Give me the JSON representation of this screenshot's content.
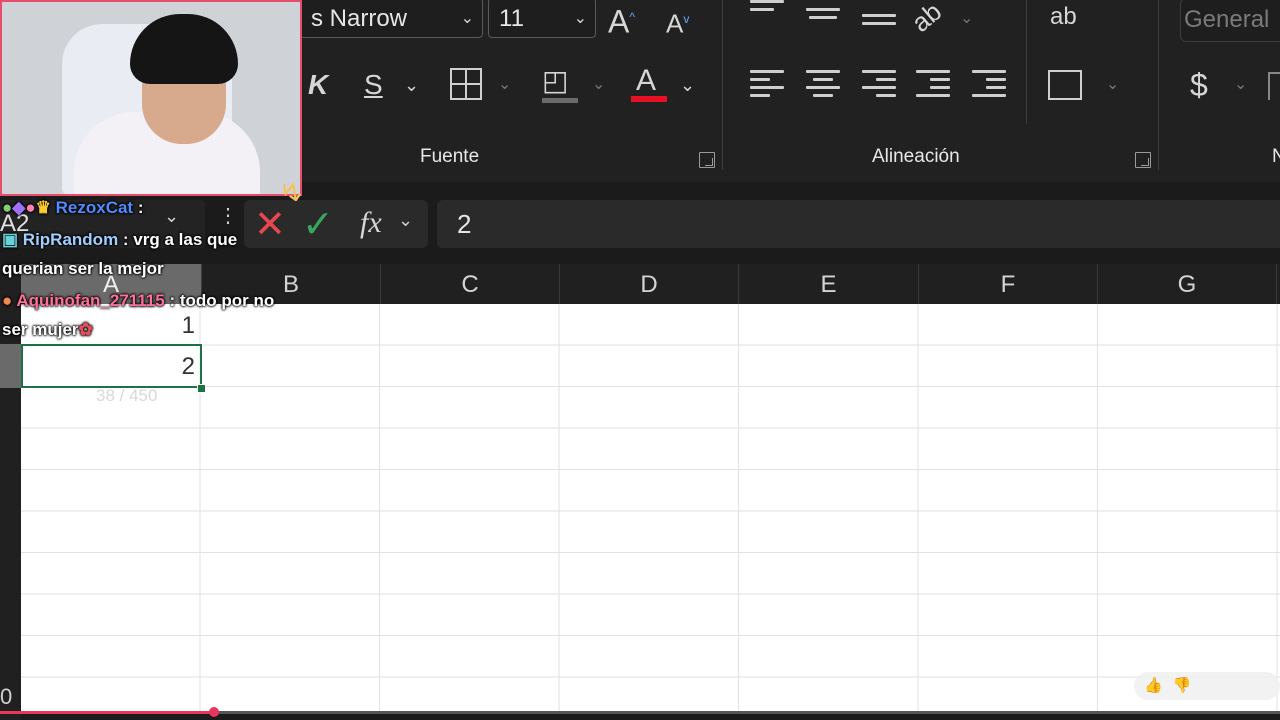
{
  "ribbon": {
    "font_name": "s Narrow",
    "font_size": "11",
    "grow_font": "A",
    "shrink_font": "A",
    "italic_label": "K",
    "strike_label": "S",
    "font_color_label": "A",
    "accent_color": "#e81123",
    "fuente_label": "Fuente",
    "alineacion_label": "Alineación",
    "number_format": "General",
    "currency_label": "$",
    "next_group_label": "N"
  },
  "formula_bar": {
    "name_box": "A2",
    "fx_label": "fx",
    "value": "2"
  },
  "columns": [
    "A",
    "B",
    "C",
    "D",
    "E",
    "F",
    "G"
  ],
  "row_labels": [
    "0"
  ],
  "cells": {
    "A1": "1",
    "A2": "2"
  },
  "chat": [
    {
      "user": "RezoxCat",
      "sep": " :",
      "text": "",
      "color": "#4f8cff"
    },
    {
      "user": "RipRandom",
      "sep": " :",
      "text": " vrg a las que",
      "color": "#4f8cff"
    },
    {
      "user": "",
      "sep": "",
      "text": "querian ser la mejor",
      "color": ""
    },
    {
      "user": "Aquinofan_271115",
      "sep": " :",
      "text": " todo por no",
      "color": "#ff6f9a"
    },
    {
      "user": "",
      "sep": "",
      "text": "ser mujer",
      "color": ""
    }
  ],
  "char_counter": "38 / 450",
  "video": {
    "progress": 0.167,
    "accent": "#e8365d"
  }
}
